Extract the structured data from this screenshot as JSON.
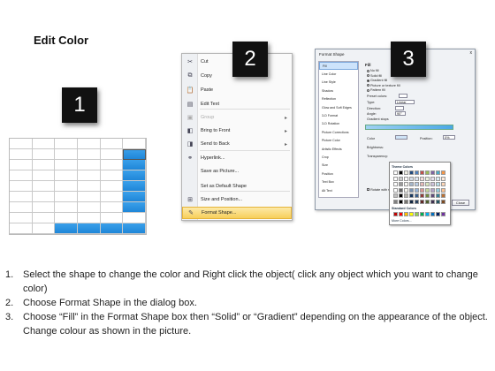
{
  "title": "Edit Color",
  "badges": [
    "1",
    "2",
    "3"
  ],
  "menu": {
    "items": [
      {
        "label": "Cut",
        "icon": "cut-icon"
      },
      {
        "label": "Copy",
        "icon": "copy-icon"
      },
      {
        "label": "Paste",
        "icon": "paste-icon"
      },
      {
        "label": "Edit Text",
        "icon": "edit-text-icon"
      },
      {
        "label": "Group",
        "icon": "group-icon",
        "submenu": true,
        "disabled": true
      },
      {
        "label": "Bring to Front",
        "icon": "bring-front-icon",
        "submenu": true
      },
      {
        "label": "Send to Back",
        "icon": "send-back-icon",
        "submenu": true
      },
      {
        "label": "Hyperlink...",
        "icon": "hyperlink-icon"
      },
      {
        "label": "Save as Picture...",
        "icon": ""
      },
      {
        "label": "Set as Default Shape",
        "icon": ""
      },
      {
        "label": "Size and Position...",
        "icon": "size-icon"
      },
      {
        "label": "Format Shape...",
        "icon": "format-shape-icon",
        "highlighted": true
      }
    ]
  },
  "dialog": {
    "title": "Format Shape",
    "close_x": "x",
    "nav": [
      "Fill",
      "Line Color",
      "Line Style",
      "Shadow",
      "Reflection",
      "Glow and Soft Edges",
      "3-D Format",
      "3-D Rotation",
      "Picture Corrections",
      "Picture Color",
      "Artistic Effects",
      "Crop",
      "Size",
      "Position",
      "Text Box",
      "Alt Text"
    ],
    "fill_heading": "Fill",
    "options": [
      "No fill",
      "Solid fill",
      "Gradient fill",
      "Picture or texture fill",
      "Pattern fill"
    ],
    "preset_label": "Preset colors:",
    "type_label": "Type:",
    "type_value": "Linear",
    "direction_label": "Direction:",
    "angle_label": "Angle:",
    "angle_value": "90°",
    "stops_label": "Gradient stops",
    "color_label": "Color",
    "position_label": "Position:",
    "position_value": "0%",
    "brightness_label": "Brightness:",
    "transparency_label": "Transparency:",
    "rotate_label": "Rotate with shape",
    "close_button": "Close"
  },
  "palette": {
    "theme_label": "Theme Colors",
    "standard_label": "Standard Colors",
    "more_label": "More Colors...",
    "theme_colors": [
      "#ffffff",
      "#000000",
      "#eeece1",
      "#1f497d",
      "#4f81bd",
      "#c0504d",
      "#9bbb59",
      "#8064a2",
      "#4bacc6",
      "#f79646"
    ],
    "standard_colors": [
      "#c00000",
      "#ff0000",
      "#ffc000",
      "#ffff00",
      "#92d050",
      "#00b050",
      "#00b0f0",
      "#0070c0",
      "#002060",
      "#7030a0"
    ]
  },
  "steps": [
    {
      "n": "1.",
      "text": "Select the shape to change the color and Right click the object( click any object which you want to change color)"
    },
    {
      "n": "2.",
      "text": "Choose Format Shape in the dialog box."
    },
    {
      "n": "3.",
      "text": "Choose “Fill” in the Format Shape box then “Solid” or “Gradient” depending on the appearance of the object. Change colour as shown in the picture."
    }
  ]
}
